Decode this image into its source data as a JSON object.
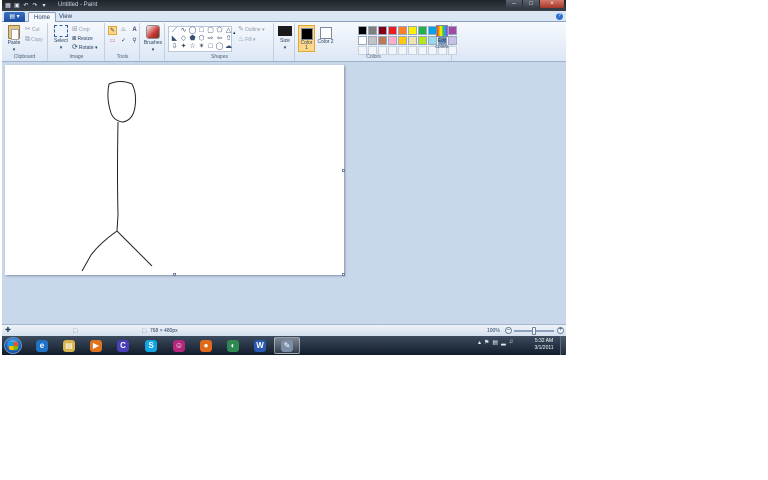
{
  "window": {
    "title": "Untitled - Paint",
    "file_menu": "▤ ▾"
  },
  "tabs": [
    {
      "label": "Home",
      "active": true
    },
    {
      "label": "View",
      "active": false
    }
  ],
  "ribbon": {
    "clipboard": {
      "label": "Clipboard",
      "paste": "Paste",
      "cut": "Cut",
      "copy": "Copy"
    },
    "image": {
      "label": "Image",
      "select": "Select",
      "crop": "Crop",
      "resize": "Resize",
      "rotate": "Rotate ▾"
    },
    "tools": {
      "label": "Tools"
    },
    "brushes": {
      "label": "Brushes"
    },
    "shapes": {
      "label": "Shapes",
      "outline": "Outline ▾",
      "fill": "Fill ▾"
    },
    "size": {
      "label": "Size"
    },
    "colors": {
      "label": "Colors",
      "color1_label": "Color 1",
      "color2_label": "Color 2",
      "edit_colors": "Edit colors",
      "color1": "#000000",
      "color2": "#ffffff",
      "palette_row1": [
        "#000000",
        "#7f7f7f",
        "#880015",
        "#ed1c24",
        "#ff7f27",
        "#fff200",
        "#22b14c",
        "#00a2e8",
        "#3f48cc",
        "#a349a4"
      ],
      "palette_row2": [
        "#ffffff",
        "#c3c3c3",
        "#b97a57",
        "#ffaec9",
        "#ffc90e",
        "#efe4b0",
        "#b5e61d",
        "#99d9ea",
        "#7092be",
        "#c8bfe7"
      ]
    }
  },
  "status": {
    "dimensions": "768 × 480px",
    "zoom": "100%"
  },
  "taskbar": {
    "time": "5:32 AM",
    "date": "3/1/2011",
    "apps": [
      {
        "name": "internet-explorer",
        "glyph": "e",
        "color": "#1f73c7"
      },
      {
        "name": "windows-explorer",
        "glyph": "▤",
        "color": "#d8b44a"
      },
      {
        "name": "media-player",
        "glyph": "▶",
        "color": "#e0731c"
      },
      {
        "name": "app-c",
        "glyph": "C",
        "color": "#4a3fb8"
      },
      {
        "name": "skype",
        "glyph": "S",
        "color": "#12a5e6"
      },
      {
        "name": "messenger",
        "glyph": "☺",
        "color": "#b5267c"
      },
      {
        "name": "firefox",
        "glyph": "●",
        "color": "#e06a1a"
      },
      {
        "name": "media-center",
        "glyph": "◐",
        "color": "#2f8a52"
      },
      {
        "name": "word",
        "glyph": "W",
        "color": "#2a5bb3"
      },
      {
        "name": "paint",
        "glyph": "✎",
        "color": "#7d8fa8",
        "active": true
      }
    ]
  }
}
